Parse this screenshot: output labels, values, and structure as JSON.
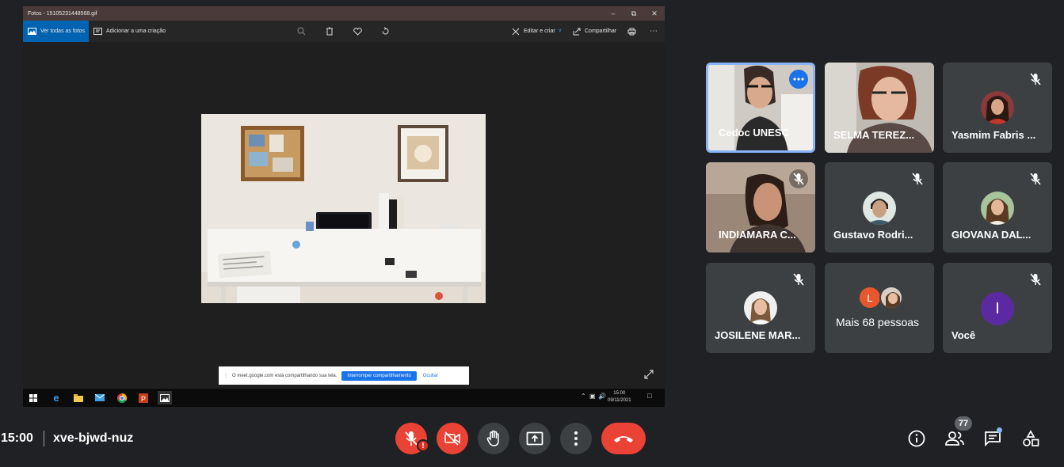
{
  "shared_screen": {
    "window_title": "Fotos - 15105231448568.gif",
    "toolbar": {
      "view_all": "Ver todas as fotos",
      "add_to_creation": "Adicionar a uma criação",
      "edit_create": "Editar e criar",
      "share": "Compartilhar"
    },
    "share_banner": {
      "message": "O meet.google.com está compartilhando sua tela.",
      "stop_button": "Interromper compartilhamento",
      "hide_link": "Ocultar"
    },
    "taskbar": {
      "time": "15:00",
      "date": "09/11/2021"
    }
  },
  "participants": [
    {
      "name": "Cedoc UNESC",
      "muted": false,
      "video": true,
      "speaking": true
    },
    {
      "name": "SELMA TEREZ...",
      "muted": false,
      "video": true
    },
    {
      "name": "Yasmim Fabris ...",
      "muted": true,
      "video": false
    },
    {
      "name": "INDIAMARA C...",
      "muted": true,
      "video": true
    },
    {
      "name": "Gustavo Rodri...",
      "muted": true,
      "video": false
    },
    {
      "name": "GIOVANA DAL...",
      "muted": true,
      "video": false
    },
    {
      "name": "JOSILENE MAR...",
      "muted": true,
      "video": false
    },
    {
      "name": "Mais 68 pessoas",
      "muted": false,
      "video": false,
      "initial": "L"
    },
    {
      "name": "Você",
      "muted": true,
      "video": false,
      "initial": "I"
    }
  ],
  "meeting": {
    "time": "15:00",
    "code": "xve-bjwd-nuz",
    "participant_count": "77"
  },
  "colors": {
    "background": "#202124",
    "tile": "#3c4043",
    "danger": "#ea4335",
    "accent": "#8ab4f8",
    "self_avatar": "#5b2aa3",
    "other_avatar": "#e8572b"
  },
  "icons": [
    "mic-off-icon",
    "camera-off-icon",
    "hand-icon",
    "present-icon",
    "more-icon",
    "end-call-icon",
    "info-icon",
    "people-icon",
    "chat-icon",
    "activities-icon"
  ]
}
